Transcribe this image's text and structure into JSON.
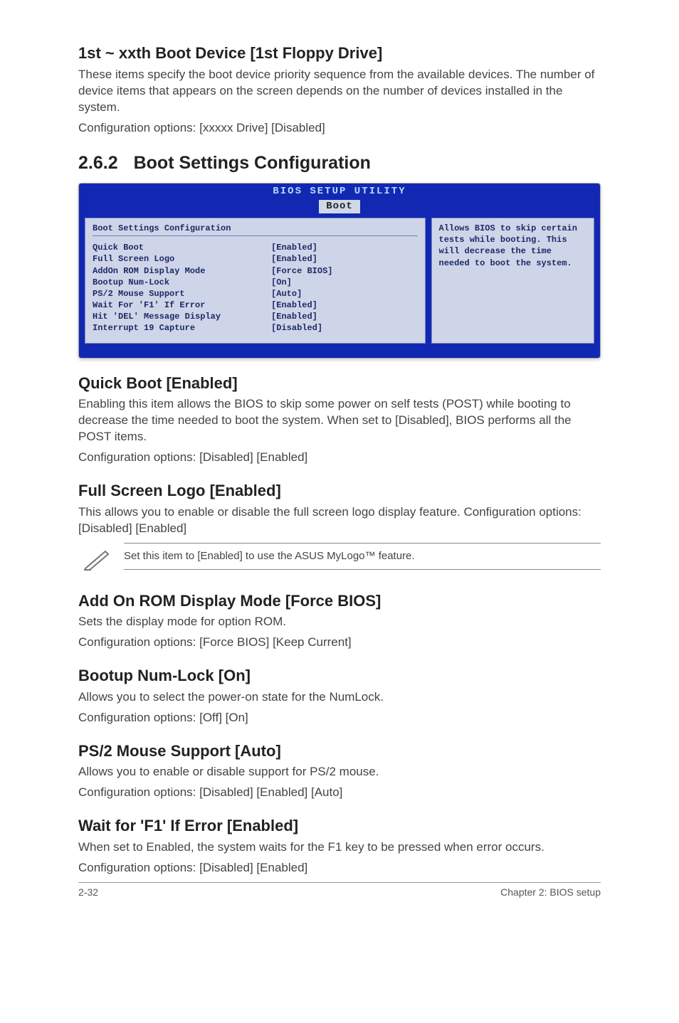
{
  "h1": {
    "title": "1st ~ xxth Boot Device [1st Floppy Drive]",
    "p1": "These items specify the boot device priority sequence from the available devices. The number of device items that appears on the screen depends on the number of devices installed in the system.",
    "p2": "Configuration options: [xxxxx Drive] [Disabled]"
  },
  "section": {
    "number": "2.6.2",
    "title": "Boot Settings Configuration"
  },
  "bios": {
    "header_title": "BIOS SETUP UTILITY",
    "tab": "Boot",
    "left_title": "Boot Settings Configuration",
    "rows": [
      {
        "label": "Quick Boot",
        "value": "[Enabled]"
      },
      {
        "label": "Full Screen Logo",
        "value": "[Enabled]"
      },
      {
        "label": "AddOn ROM Display Mode",
        "value": "[Force BIOS]"
      },
      {
        "label": "Bootup Num-Lock",
        "value": "[On]"
      },
      {
        "label": "PS/2 Mouse Support",
        "value": "[Auto]"
      },
      {
        "label": "Wait For 'F1' If Error",
        "value": "[Enabled]"
      },
      {
        "label": "Hit 'DEL' Message Display",
        "value": "[Enabled]"
      },
      {
        "label": "Interrupt 19 Capture",
        "value": "[Disabled]"
      }
    ],
    "right_text": "Allows BIOS to skip certain tests while booting. This will decrease the time needed to boot the system."
  },
  "quickboot": {
    "title": "Quick Boot [Enabled]",
    "p1": "Enabling this item allows the BIOS to skip some power on self tests (POST) while booting to decrease the time needed to boot the system. When set to [Disabled], BIOS performs all the POST items.",
    "p2": "Configuration options: [Disabled] [Enabled]"
  },
  "fullscreen": {
    "title": "Full Screen Logo [Enabled]",
    "p1": "This allows you to enable or disable the full screen logo display feature. Configuration options: [Disabled] [Enabled]"
  },
  "note": {
    "text": "Set this item to [Enabled] to use the ASUS MyLogo™ feature."
  },
  "addon": {
    "title": "Add On ROM Display Mode [Force BIOS]",
    "p1": "Sets the display mode for option ROM.",
    "p2": "Configuration options: [Force BIOS] [Keep Current]"
  },
  "numlock": {
    "title": "Bootup Num-Lock [On]",
    "p1": "Allows you to select the power-on state for the NumLock.",
    "p2": "Configuration options: [Off] [On]"
  },
  "ps2": {
    "title": "PS/2 Mouse Support [Auto]",
    "p1": "Allows you to enable or disable support for PS/2 mouse.",
    "p2": "Configuration options: [Disabled] [Enabled] [Auto]"
  },
  "waitf1": {
    "title": "Wait for 'F1' If Error [Enabled]",
    "p1": "When set to Enabled, the system waits for the F1 key to be pressed when error occurs.",
    "p2": "Configuration options: [Disabled] [Enabled]"
  },
  "footer": {
    "left": "2-32",
    "right": "Chapter 2: BIOS setup"
  }
}
